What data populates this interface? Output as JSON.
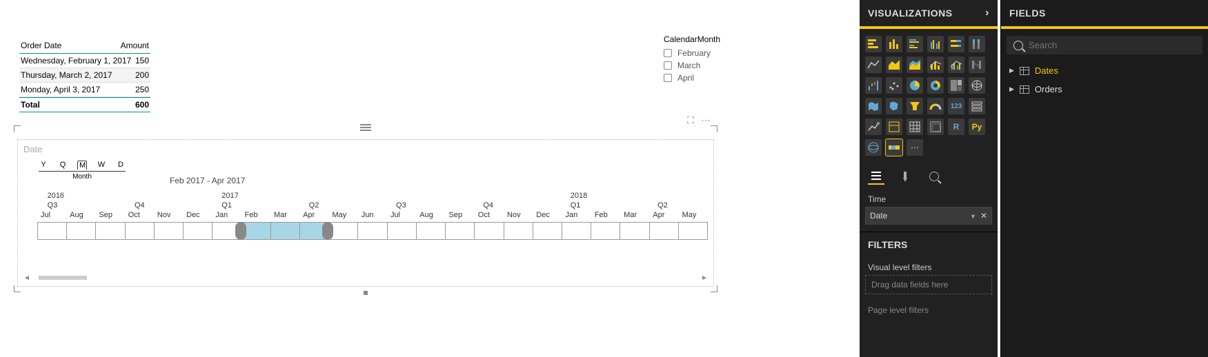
{
  "table": {
    "col1": "Order Date",
    "col2": "Amount",
    "rows": [
      {
        "date": "Wednesday, February 1, 2017",
        "amount": "150"
      },
      {
        "date": "Thursday, March 2, 2017",
        "amount": "200"
      },
      {
        "date": "Monday, April 3, 2017",
        "amount": "250"
      }
    ],
    "total_label": "Total",
    "total_value": "600"
  },
  "slicer": {
    "title": "CalendarMonth",
    "items": [
      "February",
      "March",
      "April"
    ]
  },
  "timeline": {
    "title": "Date",
    "granularity": {
      "items": [
        "Y",
        "Q",
        "M",
        "W",
        "D"
      ],
      "selected": "M",
      "selected_label": "Month"
    },
    "range_label": "Feb 2017 - Apr 2017",
    "years": [
      {
        "label": "2016",
        "pos_pct": 1.5
      },
      {
        "label": "2017",
        "pos_pct": 27.5
      },
      {
        "label": "2018",
        "pos_pct": 79.5
      }
    ],
    "quarters": [
      {
        "label": "Q3",
        "pos_pct": 1.5
      },
      {
        "label": "Q4",
        "pos_pct": 14.5
      },
      {
        "label": "Q1",
        "pos_pct": 27.5
      },
      {
        "label": "Q2",
        "pos_pct": 40.5
      },
      {
        "label": "Q3",
        "pos_pct": 53.5
      },
      {
        "label": "Q4",
        "pos_pct": 66.5
      },
      {
        "label": "Q1",
        "pos_pct": 79.5
      },
      {
        "label": "Q2",
        "pos_pct": 92.5
      }
    ],
    "months": [
      "Jul",
      "Aug",
      "Sep",
      "Oct",
      "Nov",
      "Dec",
      "Jan",
      "Feb",
      "Mar",
      "Apr",
      "May",
      "Jun",
      "Jul",
      "Aug",
      "Sep",
      "Oct",
      "Nov",
      "Dec",
      "Jan",
      "Feb",
      "Mar",
      "Apr",
      "May"
    ],
    "selected_range": {
      "start_index": 7,
      "end_index": 9
    }
  },
  "viz_panel": {
    "header": "VISUALIZATIONS",
    "tabs_selected": 0,
    "well_label": "Time",
    "well_value": "Date",
    "filters_header": "FILTERS",
    "visual_filters_label": "Visual level filters",
    "drag_placeholder": "Drag data fields here",
    "page_filters_label": "Page level filters"
  },
  "fields_panel": {
    "header": "FIELDS",
    "search_placeholder": "Search",
    "tables": [
      {
        "name": "Dates",
        "active": true
      },
      {
        "name": "Orders",
        "active": false
      }
    ]
  }
}
